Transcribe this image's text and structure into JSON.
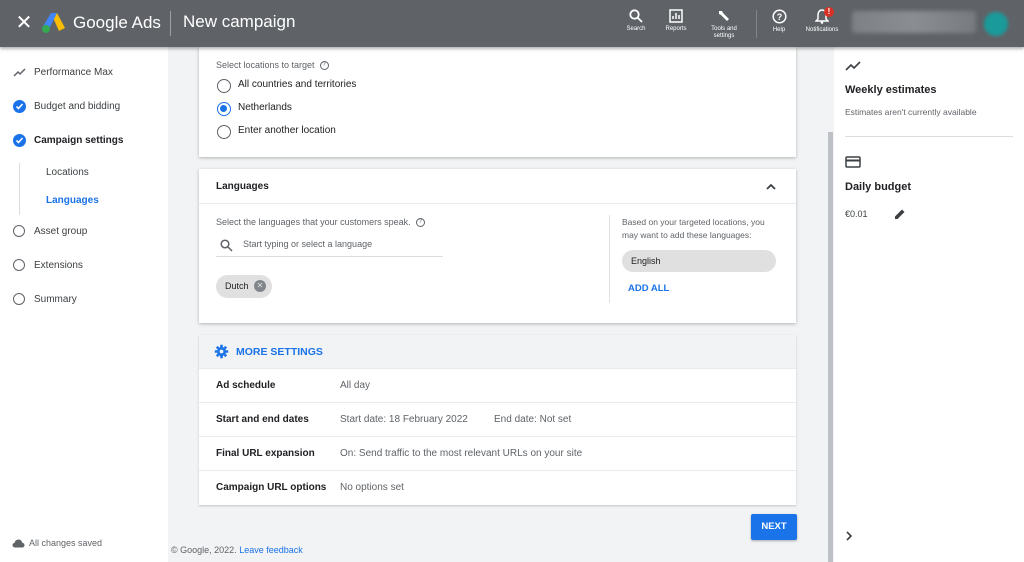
{
  "app": {
    "brand": "Google Ads",
    "page_title": "New campaign"
  },
  "toolbar": {
    "search": "Search",
    "reports": "Reports",
    "tools": "Tools and settings",
    "help": "Help",
    "notifications": "Notifications",
    "notification_badge": "!"
  },
  "sidebar": {
    "items": [
      {
        "label": "Performance Max"
      },
      {
        "label": "Budget and bidding"
      },
      {
        "label": "Campaign settings"
      },
      {
        "label": "Locations"
      },
      {
        "label": "Languages"
      },
      {
        "label": "Asset group"
      },
      {
        "label": "Extensions"
      },
      {
        "label": "Summary"
      }
    ],
    "status": "All changes saved"
  },
  "locations": {
    "label": "Select locations to target",
    "options": [
      {
        "label": "All countries and territories",
        "selected": false
      },
      {
        "label": "Netherlands",
        "selected": true
      },
      {
        "label": "Enter another location",
        "selected": false
      }
    ]
  },
  "languages": {
    "title": "Languages",
    "description": "Select the languages that your customers speak.",
    "search_placeholder": "Start typing or select a language",
    "selected": [
      "Dutch"
    ],
    "suggestion_text": "Based on your targeted locations, you may want to add these languages:",
    "suggested": [
      "English"
    ],
    "add_all": "ADD ALL"
  },
  "more_settings": {
    "title": "MORE SETTINGS",
    "rows": [
      {
        "key": "Ad schedule",
        "value": "All day",
        "value2": ""
      },
      {
        "key": "Start and end dates",
        "value": "Start date: 18 February 2022",
        "value2": "End date: Not set"
      },
      {
        "key": "Final URL expansion",
        "value": "On: Send traffic to the most relevant URLs on your site",
        "value2": ""
      },
      {
        "key": "Campaign URL options",
        "value": "No options set",
        "value2": ""
      }
    ]
  },
  "next_label": "NEXT",
  "footer": {
    "copyright": "© Google, 2022.",
    "link": "Leave feedback"
  },
  "right_panel": {
    "weekly_title": "Weekly estimates",
    "weekly_sub": "Estimates aren't currently available",
    "budget_title": "Daily budget",
    "budget_amount": "€0.01"
  },
  "colors": {
    "accent": "#1a73e8",
    "topbar": "#5f6368",
    "badge": "#d93025"
  }
}
